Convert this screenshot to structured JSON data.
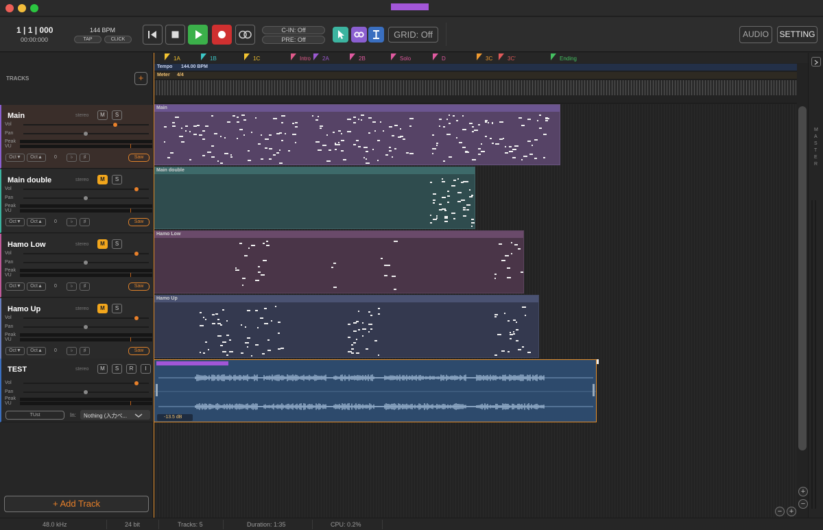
{
  "colors": {
    "accent": "#e8802a",
    "mute": "#f2a61c",
    "play": "#3bb04a",
    "record": "#d03030",
    "cursor": "#3cb4a0",
    "loop": "#8b5fd1",
    "text": "#3a6fc0",
    "main": "#564366",
    "main_double": "#2f4c4e",
    "hamo_low": "#4a3548",
    "hamo_up": "#34394f",
    "test": "#2d4a6c"
  },
  "transport": {
    "position": "1 | 1 | 000",
    "time": "00:00:000",
    "bpm": "144 BPM",
    "tap": "TAP",
    "click": "CLICK"
  },
  "toolbar": {
    "cin": "C-IN: Off",
    "pre": "PRE: Off",
    "grid": "GRID: Off",
    "audio": "AUDIO",
    "setting": "SETTING"
  },
  "sidebar": {
    "title": "TRACKS",
    "add_label": "+ Add Track"
  },
  "tracks": [
    {
      "name": "Main",
      "stereo": "stereo",
      "mute_label": "M",
      "solo_label": "S",
      "vol_label": "Vol",
      "pan_label": "Pan",
      "peak_label": "Peak",
      "vu_label": "VU",
      "oct_down": "Oct▼",
      "oct_up": "Oct▲",
      "transpose": "0",
      "flat": "♭",
      "sharp": "♯",
      "instrument": "Saw",
      "muted": false,
      "vol": 0.73
    },
    {
      "name": "Main double",
      "stereo": "stereo",
      "mute_label": "M",
      "solo_label": "S",
      "vol_label": "Vol",
      "pan_label": "Pan",
      "peak_label": "Peak",
      "vu_label": "VU",
      "oct_down": "Oct▼",
      "oct_up": "Oct▲",
      "transpose": "0",
      "flat": "♭",
      "sharp": "♯",
      "instrument": "Saw",
      "muted": true,
      "vol": 0.9
    },
    {
      "name": "Hamo Low",
      "stereo": "stereo",
      "mute_label": "M",
      "solo_label": "S",
      "vol_label": "Vol",
      "pan_label": "Pan",
      "peak_label": "Peak",
      "vu_label": "VU",
      "oct_down": "Oct▼",
      "oct_up": "Oct▲",
      "transpose": "0",
      "flat": "♭",
      "sharp": "♯",
      "instrument": "Saw",
      "muted": true,
      "vol": 0.9
    },
    {
      "name": "Hamo Up",
      "stereo": "stereo",
      "mute_label": "M",
      "solo_label": "S",
      "vol_label": "Vol",
      "pan_label": "Pan",
      "peak_label": "Peak",
      "vu_label": "VU",
      "oct_down": "Oct▼",
      "oct_up": "Oct▲",
      "transpose": "0",
      "flat": "♭",
      "sharp": "♯",
      "instrument": "Saw",
      "muted": true,
      "vol": 0.9
    }
  ],
  "audio_track": {
    "name": "TEST",
    "stereo": "stereo",
    "mute_label": "M",
    "solo_label": "S",
    "rec_label": "R",
    "input_label": "I",
    "vol_label": "Vol",
    "pan_label": "Pan",
    "peak_label": "Peak",
    "vu_label": "VU",
    "tune_label": "TUst",
    "in_label": "In:",
    "input_value": "Nothing (入力ペ...",
    "level": "-13.5 dB",
    "vol": 0.9
  },
  "markers": [
    {
      "label": "1A",
      "color": "#f4c430"
    },
    {
      "label": "1B",
      "color": "#3cc8c8"
    },
    {
      "label": "1C",
      "color": "#f4c430"
    },
    {
      "label": "Intro",
      "color": "#e05a8a"
    },
    {
      "label": "2A",
      "color": "#9b59d0"
    },
    {
      "label": "2B",
      "color": "#e05aa0"
    },
    {
      "label": "Solo",
      "color": "#e05aa0"
    },
    {
      "label": "D",
      "color": "#e05aa0"
    },
    {
      "label": "3C",
      "color": "#f09a30"
    },
    {
      "label": "3C'",
      "color": "#e05a5a"
    },
    {
      "label": "Ending",
      "color": "#44c060"
    }
  ],
  "tempo": {
    "label": "Tempo",
    "value": "144.00 BPM"
  },
  "meter": {
    "label": "Meter",
    "value": "4/4"
  },
  "regions": [
    "Main",
    "Main double",
    "Hamo Low",
    "Hamo Up"
  ],
  "master_label": "MASTER",
  "status": {
    "rate": "48.0 kHz",
    "depth": "24 bit",
    "tracks": "Tracks: 5",
    "duration": "Duration: 1:35",
    "cpu": "CPU: 0.2%"
  },
  "icons": [
    "rewind-icon",
    "stop-icon",
    "play-icon",
    "record-icon",
    "loop-icon",
    "cursor-icon",
    "link-icon",
    "text-cursor-icon",
    "chevron-down-icon",
    "chevron-right-icon",
    "plus-icon",
    "minus-icon"
  ]
}
